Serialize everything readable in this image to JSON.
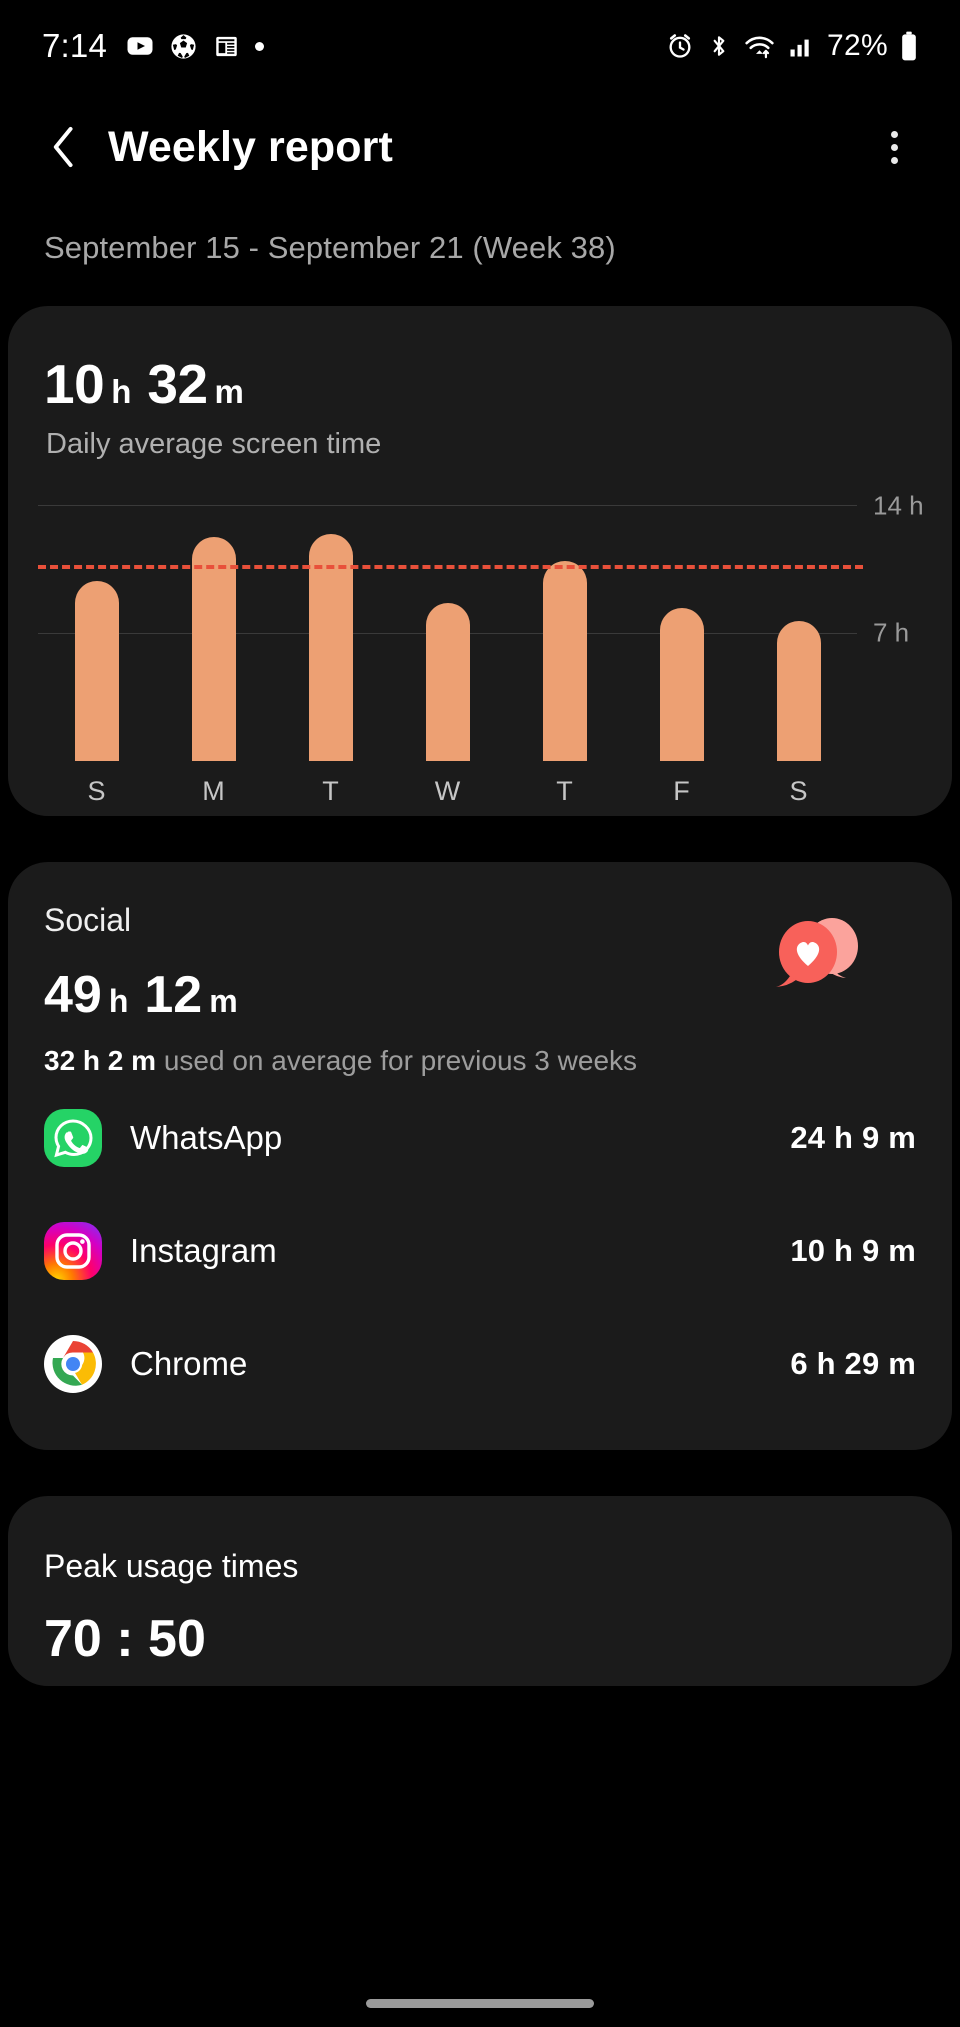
{
  "statusbar": {
    "time": "7:14",
    "left_icons": [
      "youtube-icon",
      "soccer-ball-icon",
      "news-icon",
      "dot-indicator"
    ],
    "right_icons": [
      "alarm-icon",
      "bluetooth-icon",
      "wifi-icon",
      "signal-icon"
    ],
    "battery": "72%"
  },
  "header": {
    "back": "back-icon",
    "title": "Weekly report",
    "more": "more-options-icon"
  },
  "date_range": "September 15 - September 21 (Week 38)",
  "screen_time": {
    "hours": "10",
    "h_unit": "h",
    "minutes": "32",
    "m_unit": "m",
    "label": "Daily average screen time"
  },
  "chart_data": {
    "type": "bar",
    "title": "Daily average screen time",
    "categories": [
      "S",
      "M",
      "T",
      "W",
      "T",
      "F",
      "S"
    ],
    "values": [
      9.9,
      12.3,
      12.5,
      8.7,
      11.0,
      8.4,
      7.7
    ],
    "unit": "hours",
    "ylim": [
      0,
      15.5
    ],
    "yticks": [
      7,
      14
    ],
    "ytick_labels": [
      "7 h",
      "14 h"
    ],
    "grid": true,
    "average_line": {
      "value": 10.53,
      "label": "10 h 32 m",
      "color": "#e8503a",
      "style": "dashed"
    },
    "bar_color": "#eda073",
    "xlabel": "",
    "ylabel": "",
    "legend": "none"
  },
  "social": {
    "category": "Social",
    "hours": "49",
    "h_unit": "h",
    "minutes": "12",
    "m_unit": "m",
    "average_value": "32 h 2 m",
    "average_text": " used on average for previous 3 weeks",
    "icon": "social-bubbles-heart-icon",
    "icon_color": "#f8615a",
    "apps": [
      {
        "name": "WhatsApp",
        "time": "24 h 9 m",
        "icon": "whatsapp-icon"
      },
      {
        "name": "Instagram",
        "time": "10 h 9 m",
        "icon": "instagram-icon"
      },
      {
        "name": "Chrome",
        "time": "6 h 29 m",
        "icon": "chrome-icon"
      }
    ]
  },
  "peak": {
    "title": "Peak usage times",
    "cut_text": "70 : 50"
  }
}
